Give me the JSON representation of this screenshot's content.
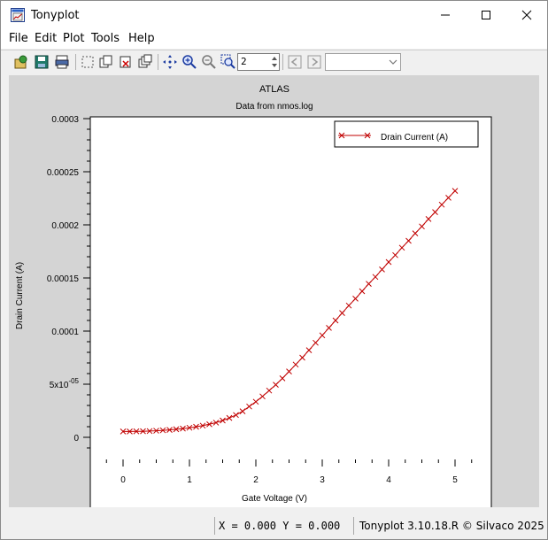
{
  "window": {
    "title": "Tonyplot"
  },
  "menu": [
    "File",
    "Edit",
    "Plot",
    "Tools",
    "Help"
  ],
  "toolbar": {
    "icons": [
      "load-icon",
      "save-icon",
      "print-icon",
      "select-icon",
      "copy-icon",
      "delete-icon",
      "duplicate-icon",
      "pan-icon",
      "zoom-in-icon",
      "zoom-out-icon",
      "zoom-box-icon"
    ],
    "spin_value": "2",
    "nav_icons": [
      "previous-icon",
      "next-icon"
    ],
    "combo_value": ""
  },
  "plot": {
    "title": "ATLAS",
    "subtitle": "Data from nmos.log",
    "legend": "Drain Current (A)",
    "xlabel": "Gate Voltage (V)",
    "ylabel": "Drain Current (A)",
    "colors": {
      "series": "#c00000",
      "panel": "#d4d4d4"
    }
  },
  "chart_data": {
    "type": "line",
    "title": "ATLAS",
    "subtitle": "Data from nmos.log",
    "xlabel": "Gate Voltage (V)",
    "ylabel": "Drain Current (A)",
    "xlim": [
      -0.5,
      5.5
    ],
    "ylim": [
      -2e-05,
      0.0003
    ],
    "x_ticks": [
      "0",
      "1",
      "2",
      "3",
      "4",
      "5"
    ],
    "y_ticks": [
      "0",
      "5x10-05",
      "0.0001",
      "0.00015",
      "0.0002",
      "0.00025",
      "0.0003"
    ],
    "legend_position": "top-right",
    "grid": false,
    "series": [
      {
        "name": "Drain Current (A)",
        "marker": "x",
        "color": "#c00000",
        "x": [
          0,
          0.1,
          0.2,
          0.3,
          0.4,
          0.5,
          0.6,
          0.7,
          0.8,
          0.9,
          1.0,
          1.1,
          1.2,
          1.3,
          1.4,
          1.5,
          1.6,
          1.7,
          1.8,
          1.9,
          2.0,
          2.1,
          2.2,
          2.3,
          2.4,
          2.5,
          2.6,
          2.7,
          2.8,
          2.9,
          3.0,
          3.1,
          3.2,
          3.3,
          3.4,
          3.5,
          3.6,
          3.7,
          3.8,
          3.9,
          4.0,
          4.1,
          4.2,
          4.3,
          4.4,
          4.5,
          4.6,
          4.7,
          4.8,
          4.9,
          5.0
        ],
        "y": [
          5.5e-06,
          5.5e-06,
          5.6e-06,
          5.7e-06,
          5.9e-06,
          6.2e-06,
          6.6e-06,
          7e-06,
          7.6e-06,
          8.2e-06,
          9e-06,
          9.9e-06,
          1.1e-05,
          1.23e-05,
          1.38e-05,
          1.58e-05,
          1.82e-05,
          2.1e-05,
          2.45e-05,
          2.9e-05,
          3.35e-05,
          3.85e-05,
          4.4e-05,
          4.95e-05,
          5.55e-05,
          6.2e-05,
          6.85e-05,
          7.5e-05,
          8.2e-05,
          8.9e-05,
          9.6e-05,
          0.000103,
          0.00011,
          0.000117,
          0.000124,
          0.0001305,
          0.0001375,
          0.0001445,
          0.000151,
          0.000158,
          0.000165,
          0.0001715,
          0.0001785,
          0.000185,
          0.000192,
          0.0001985,
          0.0002055,
          0.000212,
          0.000219,
          0.0002255,
          0.000232
        ]
      }
    ]
  },
  "status": {
    "coords": "X = 0.000 Y = 0.000",
    "version": "Tonyplot 3.10.18.R © Silvaco 2025"
  }
}
